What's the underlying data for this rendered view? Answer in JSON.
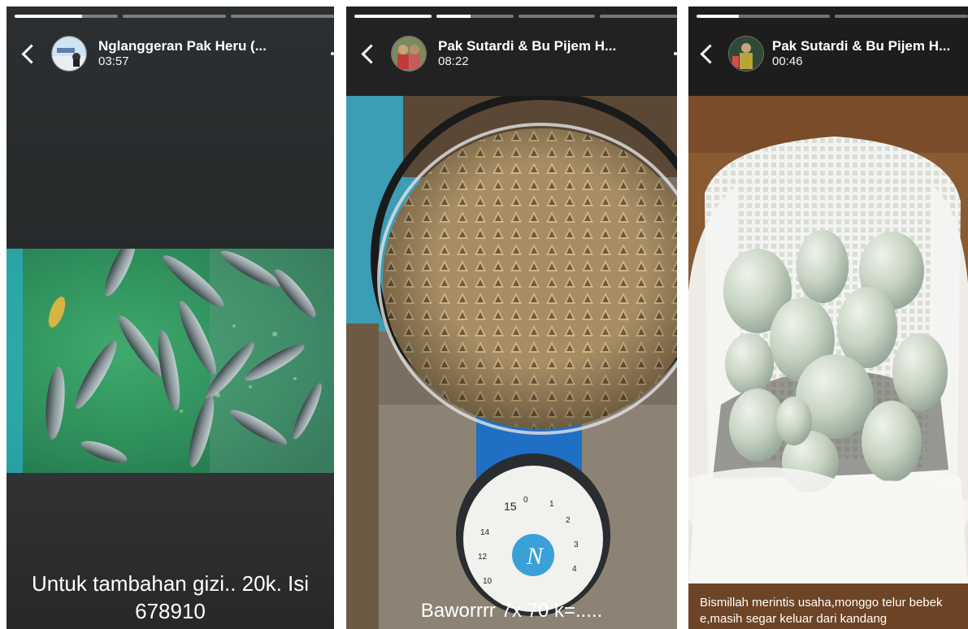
{
  "stories": [
    {
      "progress": [
        0.65,
        0,
        0
      ],
      "account_name": "Nglanggeran Pak Heru (...",
      "time": "03:57",
      "caption": "Untuk tambahan gizi.. 20k. Isi 678910"
    },
    {
      "progress": [
        1,
        0.45,
        0,
        0
      ],
      "account_name": "Pak Sutardi & Bu Pijem H...",
      "time": "08:22",
      "caption": "Baworrrr 7x 70 k=....."
    },
    {
      "progress": [
        0.32,
        0
      ],
      "account_name": "Pak Sutardi & Bu Pijem H...",
      "time": "00:46",
      "caption": "Bismillah merintis usaha,monggo telur bebek e,masih segar keluar dari kandang"
    }
  ]
}
